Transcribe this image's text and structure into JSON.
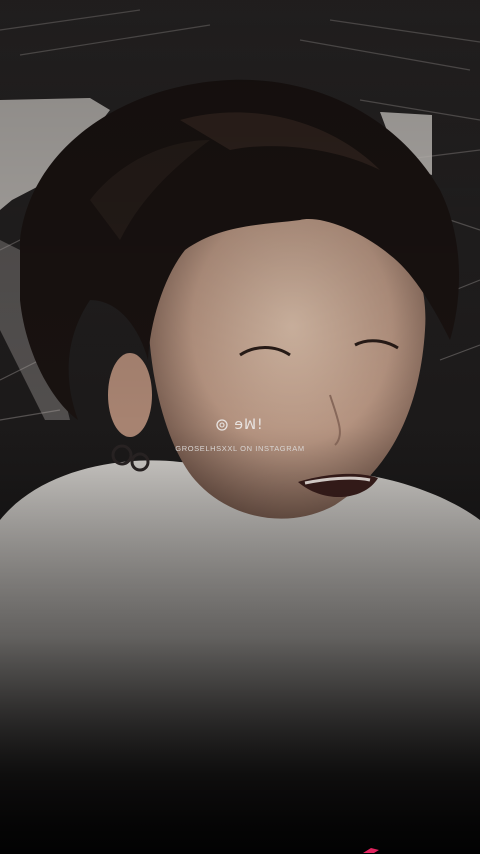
{
  "watermark": {
    "logo_text": "ɘꟽ!",
    "handle_text": "GROSELHSXXL ON INSTAGRAM"
  },
  "colors": {
    "background_top": "#1c1a1a",
    "background_bottom": "#0d0d0f",
    "shirt": "#e6e3df",
    "hair": "#1a1311",
    "skin": "#d8b9a3",
    "watermark_text": "#e8e4e2",
    "corner_accent": "#e0245e"
  },
  "icons": {
    "watermark_logo": "circle-glyph-icon"
  }
}
